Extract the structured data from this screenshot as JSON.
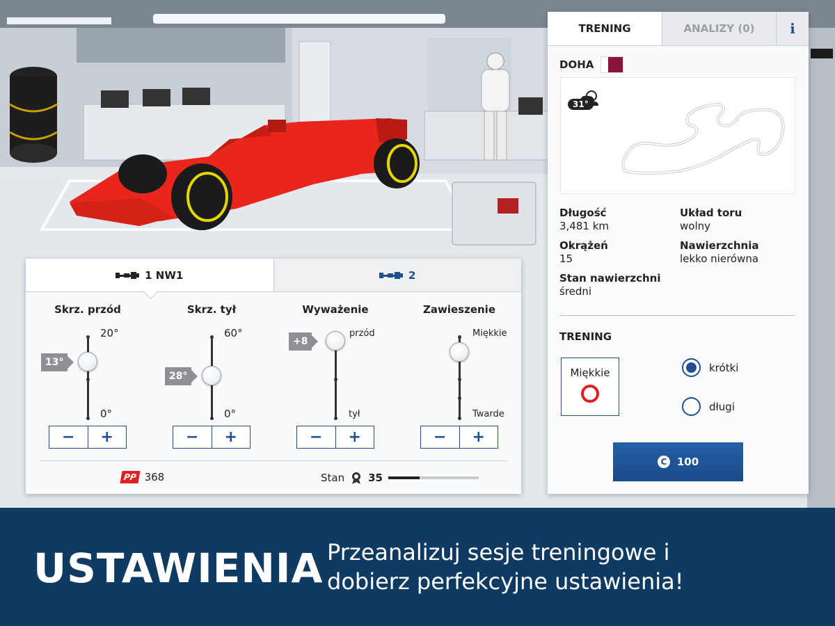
{
  "setup": {
    "car_tabs": [
      {
        "label": "1 NW1",
        "active": true
      },
      {
        "label": "2",
        "active": false
      }
    ],
    "controls": [
      {
        "title": "Skrz. przód",
        "top_label": "20°",
        "bottom_label": "0°",
        "value_label": "13°",
        "value": 13,
        "min": 0,
        "max": 20
      },
      {
        "title": "Skrz. tył",
        "top_label": "60°",
        "bottom_label": "0°",
        "value_label": "28°",
        "value": 28,
        "min": 0,
        "max": 60
      },
      {
        "title": "Wyważenie",
        "top_label": "przód",
        "bottom_label": "tył",
        "value_label": "+8"
      },
      {
        "title": "Zawieszenie",
        "top_label": "Miękkie",
        "bottom_label": "Twarde"
      }
    ],
    "stepper": {
      "minus": "−",
      "plus": "+"
    },
    "pp": {
      "badge": "PP",
      "value": "368"
    },
    "stan": {
      "label": "Stan",
      "value": "35",
      "progress_fraction": 0.35
    }
  },
  "info": {
    "tabs": {
      "training": "TRENING",
      "analysis": "ANALIZY (0)",
      "info": "i"
    },
    "city": "DOHA",
    "temperature": "31°",
    "track": {
      "length_label": "Długość",
      "length_value": "3,481 km",
      "layout_label": "Układ toru",
      "layout_value": "wolny",
      "laps_label": "Okrążeń",
      "laps_value": "15",
      "surface_label": "Nawierzchnia",
      "surface_value": "lekko nierówna",
      "condition_label": "Stan nawierzchni",
      "condition_value": "średni"
    },
    "session_title": "TRENING",
    "tyre_label": "Miękkie",
    "options": [
      {
        "label": "krótki",
        "selected": true
      },
      {
        "label": "długi",
        "selected": false
      }
    ],
    "buy": {
      "coin": "C",
      "amount": "100"
    }
  },
  "banner": {
    "title": "USTAWIENIA",
    "line1": "Przeanalizuj sesje treningowe i",
    "line2": "dobierz perfekcyjne ustawienia!"
  },
  "colors": {
    "accent": "#1f4f8f",
    "banner": "#0f3a61",
    "car": "#e8261c",
    "pp": "#e02020"
  }
}
